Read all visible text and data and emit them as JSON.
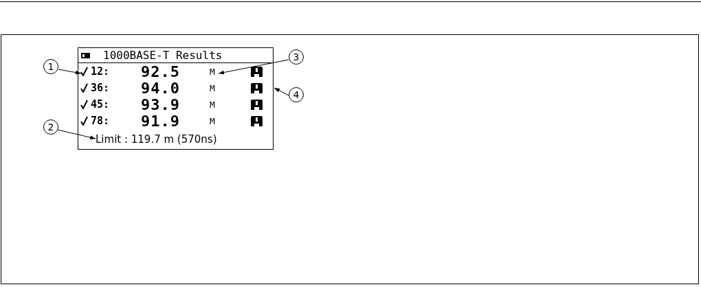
{
  "screen": {
    "title": "1000BASE-T Results",
    "rows": [
      {
        "pair": "12:",
        "checked": true,
        "value": "92.5",
        "unit": "M"
      },
      {
        "pair": "36:",
        "checked": true,
        "value": "94.0",
        "unit": "M"
      },
      {
        "pair": "45:",
        "checked": true,
        "value": "93.9",
        "unit": "M"
      },
      {
        "pair": "78:",
        "checked": true,
        "value": "91.9",
        "unit": "M"
      }
    ],
    "limit": "Limit : 119.7 m (570ns)"
  },
  "callouts": [
    {
      "label": "1"
    },
    {
      "label": "2"
    },
    {
      "label": "3"
    },
    {
      "label": "4"
    }
  ]
}
